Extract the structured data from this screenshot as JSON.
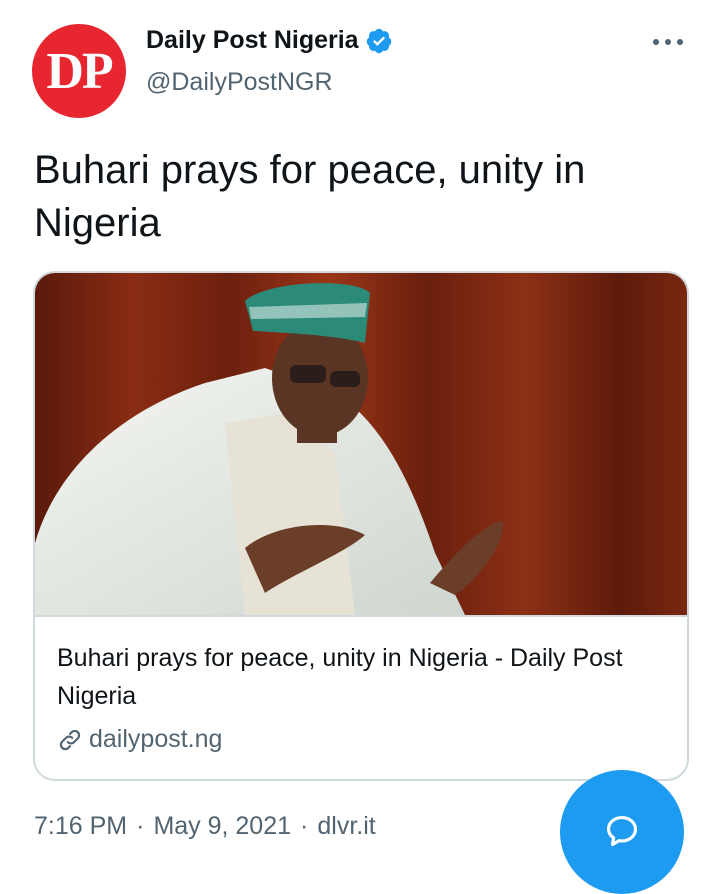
{
  "author": {
    "avatar_text": "DP",
    "display_name": "Daily Post Nigeria",
    "handle": "@DailyPostNGR",
    "verified_icon": "verified-badge-icon"
  },
  "tweet": {
    "text": "Buhari prays for peace, unity in Nigeria",
    "card": {
      "title": "Buhari prays for peace, unity in Nigeria - Daily Post Nigeria",
      "domain": "dailypost.ng",
      "image_icon": "photo-man-praying"
    },
    "time": "7:16 PM",
    "date": "May 9, 2021",
    "source": "dlvr.it"
  },
  "colors": {
    "avatar_bg": "#e8262f",
    "accent": "#1d9bf0",
    "secondary_text": "#536471"
  },
  "fab_icon": "compose-reply-icon"
}
